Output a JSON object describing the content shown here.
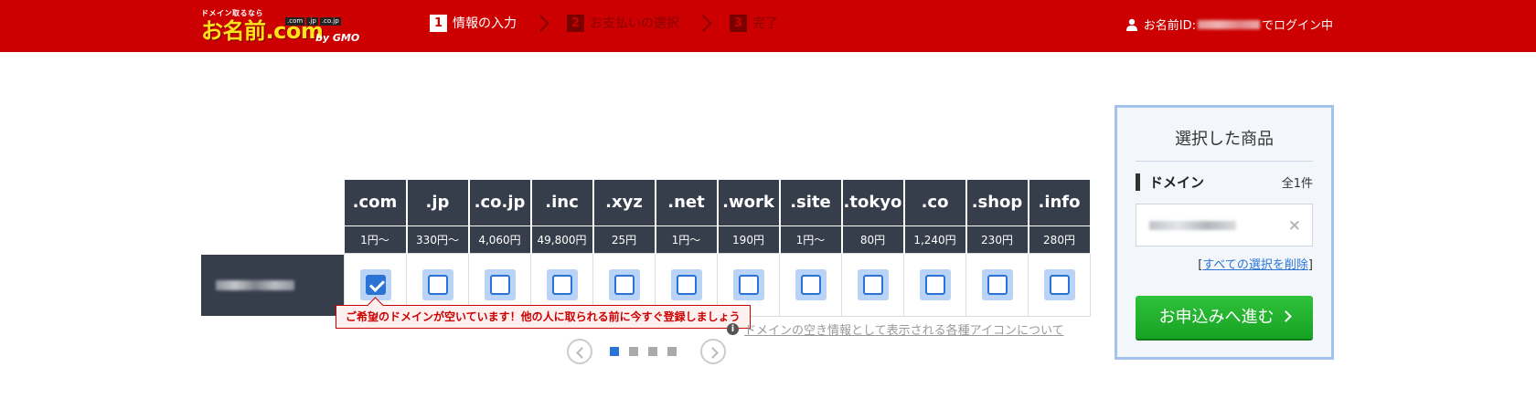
{
  "header": {
    "logo": {
      "tagline": "ドメイン取るなら",
      "main": "お名前.com",
      "tlds": [
        ".com",
        ".jp",
        ".co.jp"
      ],
      "by": "by GMO"
    },
    "steps": [
      {
        "num": "1",
        "label": "情報の入力",
        "state": "active"
      },
      {
        "num": "2",
        "label": "お支払いの選択",
        "state": "inactive"
      },
      {
        "num": "3",
        "label": "完了",
        "state": "inactive"
      }
    ],
    "login": {
      "prefix": "お名前ID:",
      "suffix": "でログイン中"
    }
  },
  "table": {
    "tlds": [
      {
        "name": ".com",
        "price": "1円～",
        "checked": true
      },
      {
        "name": ".jp",
        "price": "330円～",
        "checked": false
      },
      {
        "name": ".co.jp",
        "price": "4,060円",
        "checked": false
      },
      {
        "name": ".inc",
        "price": "49,800円",
        "checked": false
      },
      {
        "name": ".xyz",
        "price": "25円",
        "checked": false
      },
      {
        "name": ".net",
        "price": "1円～",
        "checked": false
      },
      {
        "name": ".work",
        "price": "190円",
        "checked": false
      },
      {
        "name": ".site",
        "price": "1円～",
        "checked": false
      },
      {
        "name": ".tokyo",
        "price": "80円",
        "checked": false
      },
      {
        "name": ".co",
        "price": "1,240円",
        "checked": false
      },
      {
        "name": ".shop",
        "price": "230円",
        "checked": false
      },
      {
        "name": ".info",
        "price": "280円",
        "checked": false
      }
    ]
  },
  "tooltip": "ご希望のドメインが空いています！他の人に取られる前に今すぐ登録しましょう",
  "info_link": "ドメインの空き情報として表示される各種アイコンについて",
  "pager": {
    "pages": 4,
    "active": 0
  },
  "panel": {
    "title": "選択した商品",
    "section_label": "ドメイン",
    "section_count": "全1件",
    "clear_prefix": "[",
    "clear_link": "すべての選択を削除",
    "clear_suffix": "]",
    "proceed_label": "お申込みへ進む"
  },
  "colors": {
    "header_bg": "#cc0000",
    "table_header_bg": "#363d4b",
    "accent_blue": "#2b74d6",
    "proceed_green": "#18a224"
  }
}
